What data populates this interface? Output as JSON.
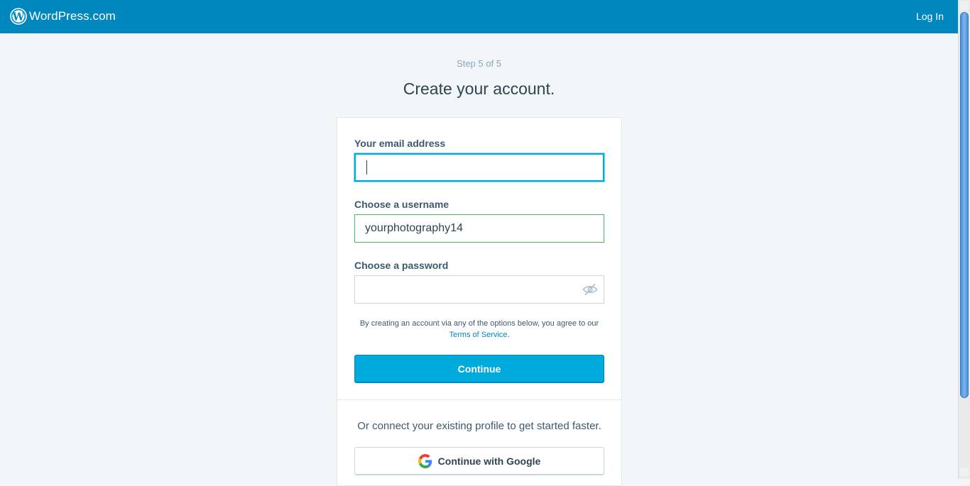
{
  "masthead": {
    "brand_name": "WordPress.com",
    "login_label": "Log In",
    "background_color": "#0087be"
  },
  "step": "Step 5 of 5",
  "title": "Create your account.",
  "form": {
    "email": {
      "label": "Your email address",
      "value": ""
    },
    "username": {
      "label": "Choose a username",
      "value": "yourphotography14"
    },
    "password": {
      "label": "Choose a password",
      "value": "",
      "toggle_icon": "eye-hidden-icon"
    },
    "terms_text": "By creating an account via any of the options below, you agree to our",
    "terms_link": "Terms of Service",
    "terms_period": ".",
    "continue_label": "Continue"
  },
  "social": {
    "text": "Or connect your existing profile to get started faster.",
    "google_label": "Continue with Google",
    "google_icon": "google-icon"
  },
  "colors": {
    "accent": "#00aadc",
    "valid": "#4ab866",
    "text": "#2e4453"
  }
}
